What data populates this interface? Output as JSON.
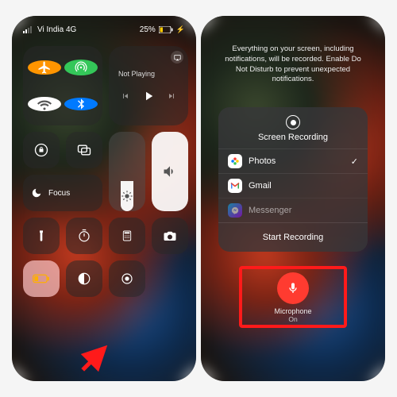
{
  "colors": {
    "airplane": "#ff9500",
    "cellular": "#34c759",
    "wifi": "#ffffff",
    "bluetooth": "#007aff",
    "mic": "#ff3b30",
    "highlight": "#ff1a1a"
  },
  "statusbar": {
    "carrier": "Vi India 4G",
    "battery": "25%"
  },
  "media": {
    "status": "Not Playing"
  },
  "focus": {
    "label": "Focus"
  },
  "right": {
    "disclaimer": "Everything on your screen, including notifications, will be recorded. Enable Do Not Disturb to prevent unexpected notifications.",
    "title": "Screen Recording",
    "apps": [
      {
        "name": "Photos",
        "selected": true
      },
      {
        "name": "Gmail",
        "selected": false
      },
      {
        "name": "Messenger",
        "selected": false
      }
    ],
    "action": "Start Recording",
    "mic_label": "Microphone",
    "mic_state": "On"
  }
}
